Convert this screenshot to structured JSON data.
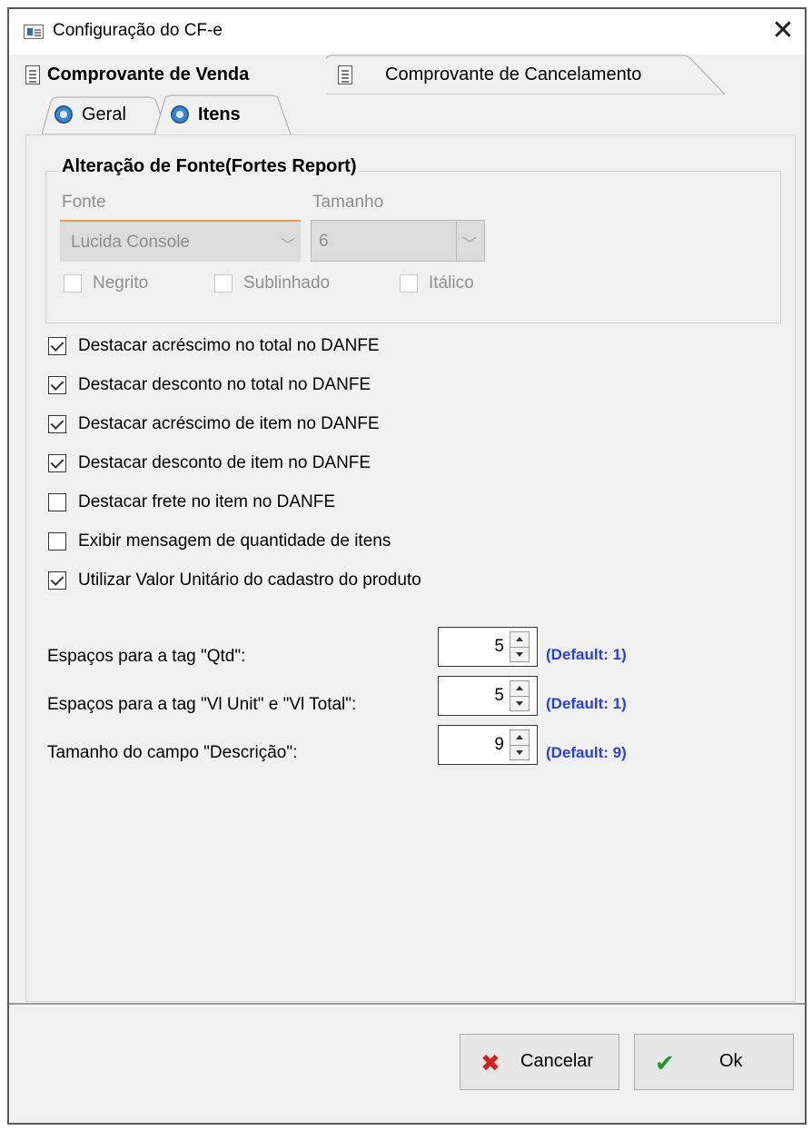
{
  "window": {
    "title": "Configuração do CF-e",
    "close_glyph": "✕"
  },
  "outer_tabs": [
    {
      "label": "Comprovante de Venda",
      "active": true
    },
    {
      "label": "Comprovante de Cancelamento",
      "active": false
    }
  ],
  "inner_tabs": [
    {
      "label": "Geral",
      "active": false
    },
    {
      "label": "Itens",
      "active": true
    }
  ],
  "font_group": {
    "title": "Alteração de Fonte(Fortes Report)",
    "fonte_label": "Fonte",
    "tamanho_label": "Tamanho",
    "fonte_value": "Lucida Console",
    "tamanho_value": "6",
    "negrito_label": "Negrito",
    "sublinhado_label": "Sublinhado",
    "italico_label": "Itálico",
    "negrito_checked": false,
    "sublinhado_checked": false,
    "italico_checked": false
  },
  "options": [
    {
      "label": "Destacar acréscimo no total no DANFE",
      "checked": true
    },
    {
      "label": "Destacar desconto no total no DANFE",
      "checked": true
    },
    {
      "label": "Destacar acréscimo de item no DANFE",
      "checked": true
    },
    {
      "label": "Destacar desconto de item no DANFE",
      "checked": true
    },
    {
      "label": "Destacar frete no item no DANFE",
      "checked": false
    },
    {
      "label": "Exibir mensagem de quantidade de itens",
      "checked": false
    },
    {
      "label": "Utilizar Valor Unitário do cadastro do produto",
      "checked": true
    }
  ],
  "fields": [
    {
      "label": "Espaços para a tag \"Qtd\":",
      "value": "5",
      "default": "(Default: 1)"
    },
    {
      "label": "Espaços para a tag \"Vl Unit\" e \"Vl Total\":",
      "value": "5",
      "default": "(Default: 1)"
    },
    {
      "label": "Tamanho do campo \"Descrição\":",
      "value": "9",
      "default": "(Default: 9)"
    }
  ],
  "buttons": {
    "cancel_label": "Cancelar",
    "ok_label": "Ok",
    "cancel_icon": "✖",
    "ok_icon": "✔"
  },
  "colors": {
    "default_text": "#2a3fe0",
    "cancel_icon": "#d62020",
    "ok_icon": "#1e9a2e"
  }
}
